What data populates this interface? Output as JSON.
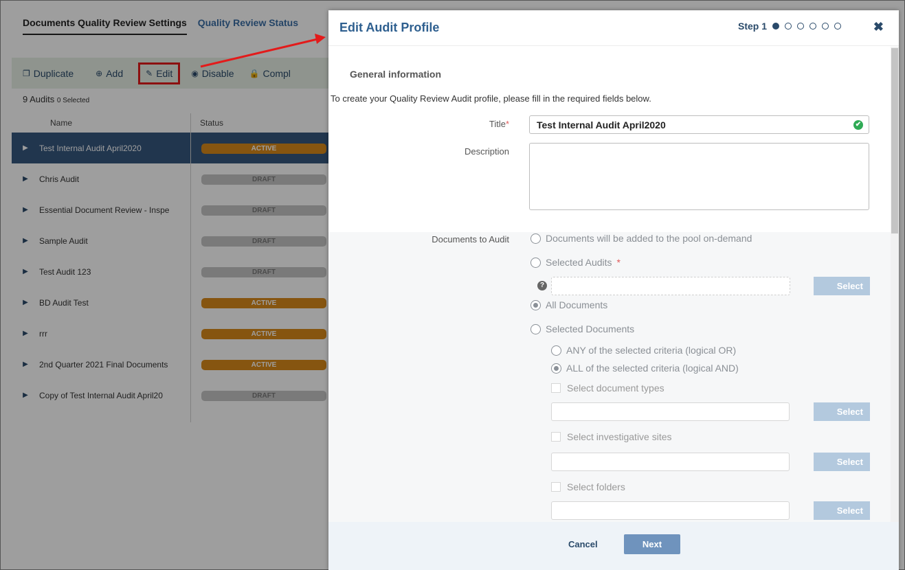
{
  "background": {
    "tabs": [
      {
        "label": "Documents Quality Review Settings",
        "active": true
      },
      {
        "label": "Quality Review Status",
        "active": false
      }
    ],
    "toolbar": {
      "duplicate": "Duplicate",
      "add": "Add",
      "edit": "Edit",
      "disable": "Disable",
      "complete": "Compl"
    },
    "audit_count": "9 Audits",
    "selected_count": "0 Selected",
    "columns": {
      "name": "Name",
      "status": "Status"
    },
    "rows": [
      {
        "name": "Test Internal Audit April2020",
        "status": "ACTIVE"
      },
      {
        "name": "Chris Audit",
        "status": "DRAFT"
      },
      {
        "name": "Essential Document Review - Inspe",
        "status": "DRAFT"
      },
      {
        "name": "Sample Audit",
        "status": "DRAFT"
      },
      {
        "name": "Test Audit 123",
        "status": "DRAFT"
      },
      {
        "name": "BD Audit Test",
        "status": "ACTIVE"
      },
      {
        "name": "rrr",
        "status": "ACTIVE"
      },
      {
        "name": "2nd Quarter 2021 Final Documents",
        "status": "ACTIVE"
      },
      {
        "name": "Copy of Test Internal Audit April20",
        "status": "DRAFT"
      }
    ]
  },
  "modal": {
    "title": "Edit Audit Profile",
    "step_label": "Step 1",
    "step_current": 1,
    "step_total": 6,
    "close_icon": "close-icon",
    "section_title": "General information",
    "intro": "To create your Quality Review Audit profile, please fill in the required fields below.",
    "title_label": "Title",
    "title_required_mark": "*",
    "title_value": "Test Internal Audit April2020",
    "description_label": "Description",
    "description_value": "",
    "documents_label": "Documents to Audit",
    "options": {
      "on_demand": "Documents will be added to the pool on-demand",
      "selected_audits": "Selected Audits",
      "selected_audits_req": "*",
      "all_documents": "All Documents",
      "selected_documents": "Selected Documents",
      "any_criteria": "ANY of the selected criteria (logical OR)",
      "all_criteria": "ALL of the selected criteria (logical AND)",
      "doc_types": "Select document types",
      "inv_sites": "Select investigative sites",
      "folders": "Select folders"
    },
    "select_label": "Select",
    "help_icon": "help-icon",
    "cancel": "Cancel",
    "next": "Next"
  },
  "colors": {
    "accent": "#2e5f8f",
    "active_badge": "#d98a1a",
    "draft_badge": "#c6c6c6",
    "highlight": "#e31b1b",
    "selected_row": "#36577f"
  }
}
